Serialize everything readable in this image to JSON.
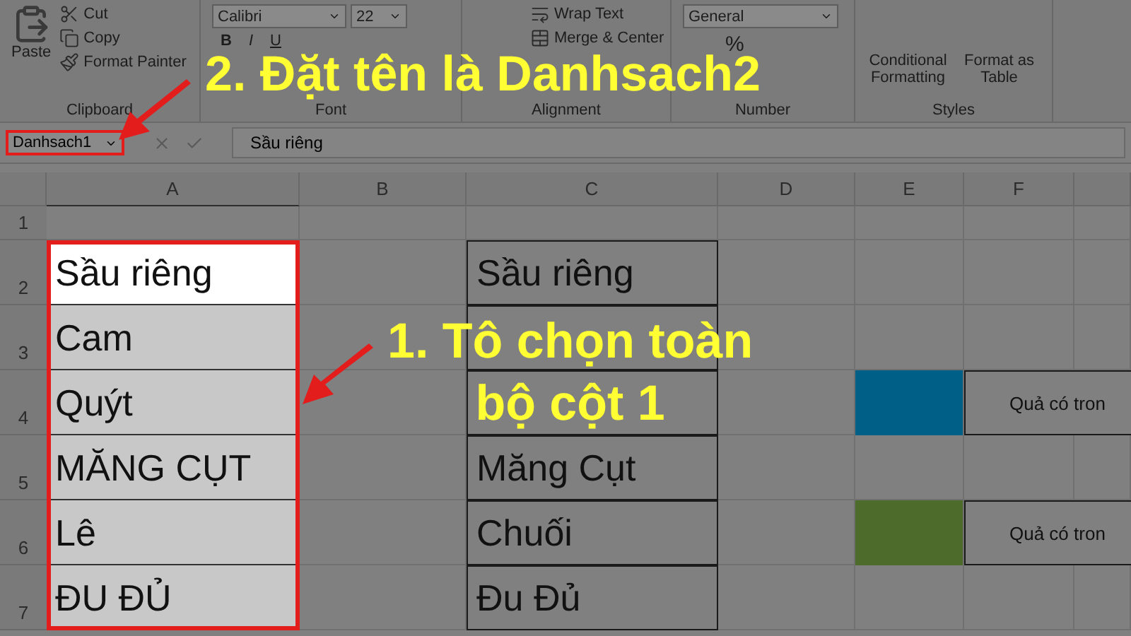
{
  "ribbon": {
    "groups": [
      {
        "kind": "clipboard",
        "label": "Clipboard",
        "paste": "Paste",
        "items": [
          "Cut",
          "Copy",
          "Format Painter"
        ]
      },
      {
        "kind": "font",
        "label": "Font",
        "font": "Calibri",
        "size": "22",
        "styles": [
          "B",
          "I",
          "U"
        ]
      },
      {
        "kind": "alignment",
        "label": "Alignment",
        "items": [
          "Wrap Text",
          "Merge & Center"
        ]
      },
      {
        "kind": "number",
        "label": "Number",
        "format": "General",
        "percent": "%"
      },
      {
        "kind": "styles",
        "label": "Styles",
        "items": [
          "Conditional Formatting",
          "Format as Table"
        ]
      }
    ]
  },
  "formula_bar": {
    "name_box": "Danhsach1",
    "highlighted": true,
    "value": "Sầu riêng"
  },
  "sheet": {
    "columns": [
      "A",
      "B",
      "C",
      "D",
      "E",
      "F",
      ""
    ],
    "rows": [
      {
        "number": "1"
      },
      {
        "number": "2",
        "cells": [
          {
            "kind": "plain",
            "text": "Sầu riêng",
            "selected": true,
            "active": true
          },
          {
            "kind": "empty"
          },
          {
            "kind": "boxed",
            "text": "Sầu riêng",
            "selected": false
          }
        ]
      },
      {
        "number": "3",
        "cells": [
          {
            "kind": "plain",
            "text": "Cam",
            "selected": true,
            "active": false
          },
          {
            "kind": "empty"
          },
          {
            "kind": "boxed",
            "selected": false
          }
        ]
      },
      {
        "number": "4",
        "cells": [
          {
            "kind": "plain",
            "text": "Quýt",
            "selected": true,
            "active": false
          },
          {
            "kind": "empty"
          },
          {
            "kind": "boxed",
            "selected": false
          },
          {
            "kind": "empty"
          },
          {
            "kind": "fill",
            "color": "#005f86"
          },
          {
            "kind": "note",
            "text": "Quả có tron"
          }
        ]
      },
      {
        "number": "5",
        "cells": [
          {
            "kind": "plain",
            "text": "MĂNG CỤT",
            "selected": true,
            "active": false
          },
          {
            "kind": "empty"
          },
          {
            "kind": "boxed",
            "text": "Măng Cụt",
            "selected": false
          }
        ]
      },
      {
        "number": "6",
        "cells": [
          {
            "kind": "plain",
            "text": "Lê",
            "selected": true,
            "active": false
          },
          {
            "kind": "empty"
          },
          {
            "kind": "boxed",
            "text": "Chuối",
            "selected": false
          },
          {
            "kind": "empty"
          },
          {
            "kind": "fill",
            "color": "#4d6b2a"
          },
          {
            "kind": "note",
            "text": "Quả có tron"
          }
        ]
      },
      {
        "number": "7",
        "cells": [
          {
            "kind": "plain",
            "text": "ĐU ĐỦ",
            "selected": true,
            "active": false
          },
          {
            "kind": "empty"
          },
          {
            "kind": "boxed",
            "text": "Đu Đủ",
            "selected": false
          }
        ]
      }
    ]
  },
  "annotations": [
    {
      "kind": "callout",
      "lines": [
        "2. Đặt tên là Danhsach2"
      ]
    },
    {
      "kind": "callout",
      "lines": [
        "1. Tô chọn toàn",
        "bộ cột 1"
      ]
    }
  ]
}
